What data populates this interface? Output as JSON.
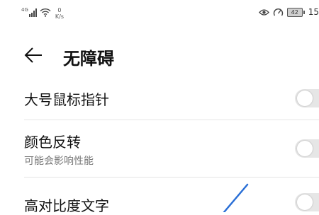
{
  "status_bar": {
    "network": "4G",
    "speed_value": "0",
    "speed_unit": "K/s",
    "battery": "42",
    "time": "15"
  },
  "header": {
    "title": "无障碍"
  },
  "settings": [
    {
      "title": "大号鼠标指针",
      "enabled": false
    },
    {
      "title": "颜色反转",
      "subtitle": "可能会影响性能",
      "enabled": false
    },
    {
      "title": "高对比度文字",
      "enabled": false
    }
  ],
  "colors": {
    "toggle_off_track": "#e6e6e6",
    "divider": "#e5e5e5",
    "annotation_line": "#2a6fd6"
  }
}
